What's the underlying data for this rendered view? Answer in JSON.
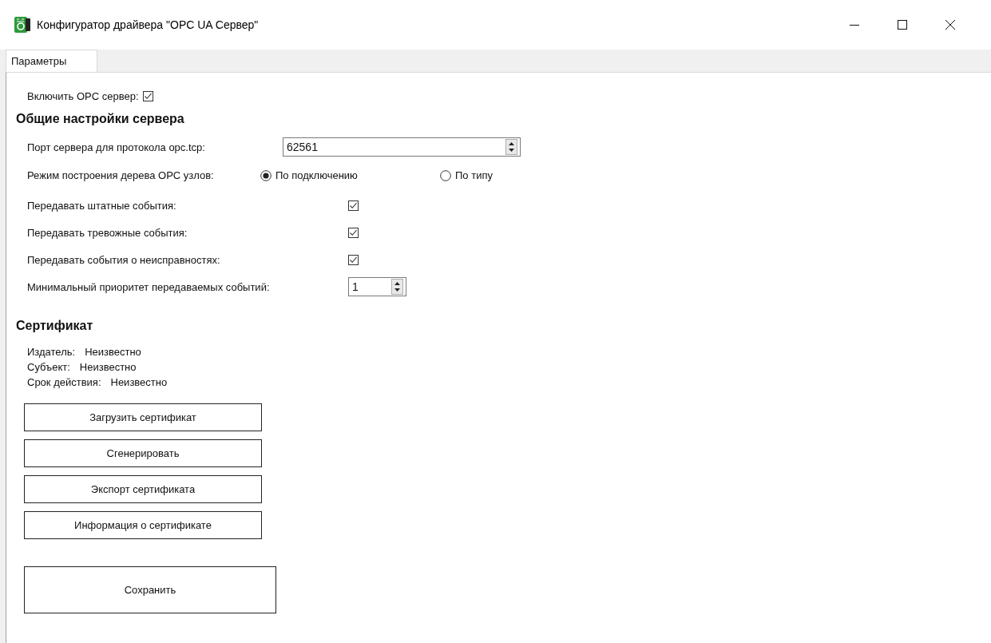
{
  "window": {
    "title": "Конфигуратор драйвера \"OPC UA Сервер\""
  },
  "tabs": [
    {
      "label": "Параметры",
      "selected": true
    }
  ],
  "enable_server": {
    "label": "Включить OPC сервер:",
    "checked": true
  },
  "general": {
    "heading": "Общие настройки сервера",
    "port": {
      "label": "Порт сервера для протокола opc.tcp:",
      "value": "62561"
    },
    "tree_mode": {
      "label": "Режим построения дерева OPC узлов:",
      "options": [
        {
          "label": "По подключению",
          "selected": true
        },
        {
          "label": "По типу",
          "selected": false
        }
      ]
    },
    "event_options": [
      {
        "label": "Передавать штатные события:",
        "checked": true
      },
      {
        "label": "Передавать тревожные события:",
        "checked": true
      },
      {
        "label": "Передавать события о неисправностях:",
        "checked": true
      }
    ],
    "min_priority": {
      "label": "Минимальный приоритет передаваемых событий:",
      "value": "1"
    }
  },
  "certificate": {
    "heading": "Сертификат",
    "fields": [
      {
        "label": "Издатель:",
        "value": "Неизвестно"
      },
      {
        "label": "Субъект:",
        "value": "Неизвестно"
      },
      {
        "label": "Срок действия:",
        "value": "Неизвестно"
      }
    ],
    "buttons": [
      "Загрузить сертификат",
      "Сгенерировать",
      "Экспорт сертификата",
      "Информация о сертификате"
    ]
  },
  "save_button": "Сохранить"
}
